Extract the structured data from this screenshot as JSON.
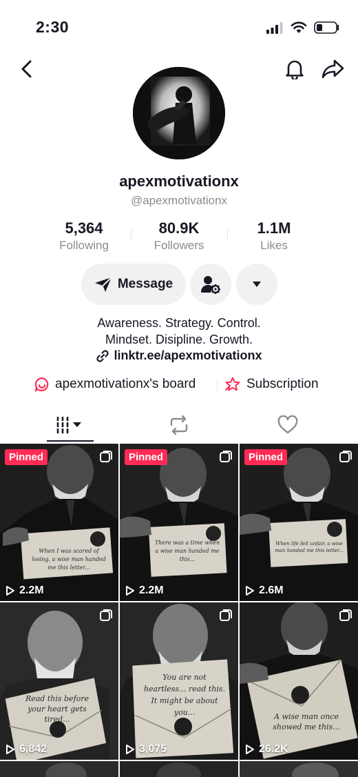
{
  "status_bar": {
    "time": "2:30"
  },
  "profile": {
    "display_name": "apexmotivationx",
    "handle": "@apexmotivationx",
    "stats": [
      {
        "value": "5,364",
        "label": "Following"
      },
      {
        "value": "80.9K",
        "label": "Followers"
      },
      {
        "value": "1.1M",
        "label": "Likes"
      }
    ],
    "actions": {
      "message_label": "Message"
    },
    "bio_line1": "Awareness. Strategy. Control.",
    "bio_line2": "Mindset. Disipline. Growth.",
    "link": "linktr.ee/apexmotivationx",
    "board_label": "apexmotivationx's board",
    "subscription_label": "Subscription"
  },
  "colors": {
    "accent": "#fe2c55",
    "text": "#161823",
    "muted": "#8a8b91"
  },
  "videos": [
    {
      "pinned": "Pinned",
      "views": "2.2M",
      "caption": "When I was scared of losing, a wise man handed me this letter..."
    },
    {
      "pinned": "Pinned",
      "views": "2.2M",
      "caption": "There was a time when a wise man handed me this..."
    },
    {
      "pinned": "Pinned",
      "views": "2.6M",
      "caption": "When life felt unfair, a wise man handed me this letter..."
    },
    {
      "pinned": "",
      "views": "6,842",
      "caption": "Read this before your heart gets tired..."
    },
    {
      "pinned": "",
      "views": "3,075",
      "caption": "You are not heartless... read this. It might be about you..."
    },
    {
      "pinned": "",
      "views": "26.2K",
      "caption": "A wise man once showed me this..."
    }
  ]
}
